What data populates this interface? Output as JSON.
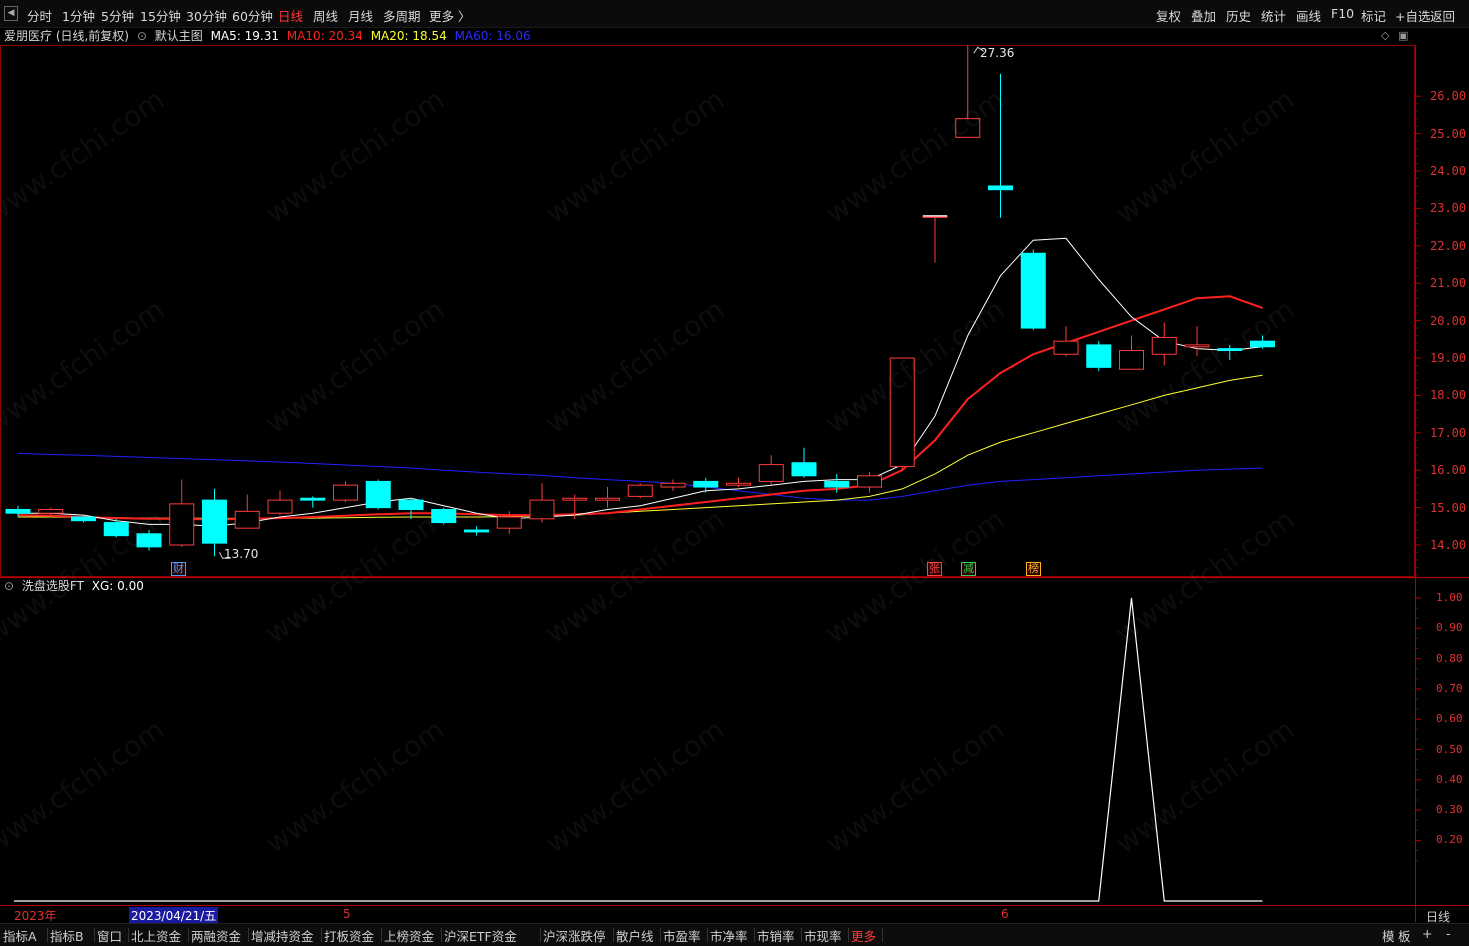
{
  "toolbar": {
    "periods": [
      "分时",
      "1分钟",
      "5分钟",
      "15分钟",
      "30分钟",
      "60分钟",
      "日线",
      "周线",
      "月线",
      "多周期",
      "更多 〉"
    ],
    "active_period": "日线",
    "tools": [
      "复权",
      "叠加",
      "历史",
      "统计",
      "画线",
      "F10",
      "标记",
      "+自选",
      "返回"
    ]
  },
  "main_legend": {
    "stock": "爱朋医疗 (日线,前复权)",
    "template": "默认主图",
    "ma5": "MA5: 19.31",
    "ma10": "MA10: 20.34",
    "ma20": "MA20: 18.54",
    "ma60": "MA60: 16.06"
  },
  "sub_legend": {
    "indicator": "洗盘选股FT",
    "xg": "XG: 0.00"
  },
  "colors": {
    "up": "#ff3b3b",
    "down": "#00ffff",
    "ma5": "#ffffff",
    "ma10": "#ff2020",
    "ma20": "#ffff30",
    "ma60": "#2020ff",
    "axis": "#e03030"
  },
  "price_axis": [
    "26.00",
    "25.00",
    "24.00",
    "23.00",
    "22.00",
    "21.00",
    "20.00",
    "19.00",
    "18.00",
    "17.00",
    "16.00",
    "15.00",
    "14.00"
  ],
  "indicator_axis": [
    "1.00",
    "0.90",
    "0.80",
    "0.70",
    "0.60",
    "0.50",
    "0.40",
    "0.30",
    "0.20"
  ],
  "annotations": {
    "high": "27.36",
    "low": "13.70"
  },
  "event_tags": [
    {
      "text": "财",
      "color": "#4aa0ff"
    },
    {
      "text": "张",
      "color": "#ff3b3b"
    },
    {
      "text": "减",
      "color": "#30d050"
    },
    {
      "text": "榜",
      "color": "#ffb020"
    }
  ],
  "date_axis": {
    "year": "2023年",
    "cursor": "2023/04/21/五",
    "month5": "5",
    "month6": "6",
    "period_label": "日线"
  },
  "bottom_tabs": [
    "指标A",
    "指标B",
    "窗口",
    "北上资金",
    "两融资金",
    "增减持资金",
    "打板资金",
    "上榜资金",
    "沪深ETF资金",
    "沪深涨跌停",
    "散户线",
    "市盈率",
    "市净率",
    "市销率",
    "市现率",
    "更多"
  ],
  "right_tabs": [
    "模",
    "板",
    "+",
    "-"
  ],
  "watermark": "www.cfchi.com",
  "chart_data": [
    {
      "type": "candlestick",
      "title": "爱朋医疗 (日线,前复权)",
      "ylim": [
        13.5,
        27.6
      ],
      "candles": [
        {
          "o": 14.95,
          "c": 14.85,
          "h": 15.05,
          "l": 14.75
        },
        {
          "o": 14.85,
          "c": 14.95,
          "h": 15.0,
          "l": 14.8
        },
        {
          "o": 14.75,
          "c": 14.65,
          "h": 14.8,
          "l": 14.6
        },
        {
          "o": 14.6,
          "c": 14.25,
          "h": 14.7,
          "l": 14.2
        },
        {
          "o": 14.3,
          "c": 13.95,
          "h": 14.4,
          "l": 13.85
        },
        {
          "o": 14.0,
          "c": 15.1,
          "h": 15.75,
          "l": 13.95
        },
        {
          "o": 15.2,
          "c": 14.05,
          "h": 15.5,
          "l": 13.7
        },
        {
          "o": 14.45,
          "c": 14.9,
          "h": 15.35,
          "l": 14.45
        },
        {
          "o": 14.85,
          "c": 15.2,
          "h": 15.45,
          "l": 14.8
        },
        {
          "o": 15.25,
          "c": 15.2,
          "h": 15.3,
          "l": 15.0
        },
        {
          "o": 15.2,
          "c": 15.6,
          "h": 15.7,
          "l": 15.15
        },
        {
          "o": 15.7,
          "c": 15.0,
          "h": 15.75,
          "l": 14.95
        },
        {
          "o": 15.2,
          "c": 14.95,
          "h": 15.25,
          "l": 14.7
        },
        {
          "o": 14.95,
          "c": 14.6,
          "h": 15.0,
          "l": 14.55
        },
        {
          "o": 14.4,
          "c": 14.35,
          "h": 14.5,
          "l": 14.25
        },
        {
          "o": 14.45,
          "c": 14.75,
          "h": 14.9,
          "l": 14.3
        },
        {
          "o": 14.7,
          "c": 15.2,
          "h": 15.65,
          "l": 14.6
        },
        {
          "o": 15.2,
          "c": 15.25,
          "h": 15.35,
          "l": 14.7
        },
        {
          "o": 15.2,
          "c": 15.25,
          "h": 15.55,
          "l": 15.0
        },
        {
          "o": 15.3,
          "c": 15.6,
          "h": 15.65,
          "l": 15.25
        },
        {
          "o": 15.55,
          "c": 15.65,
          "h": 15.75,
          "l": 15.45
        },
        {
          "o": 15.7,
          "c": 15.55,
          "h": 15.8,
          "l": 15.4
        },
        {
          "o": 15.6,
          "c": 15.65,
          "h": 15.8,
          "l": 15.55
        },
        {
          "o": 15.7,
          "c": 16.15,
          "h": 16.4,
          "l": 15.6
        },
        {
          "o": 16.2,
          "c": 15.85,
          "h": 16.6,
          "l": 15.8
        },
        {
          "o": 15.7,
          "c": 15.55,
          "h": 15.9,
          "l": 15.4
        },
        {
          "o": 15.55,
          "c": 15.85,
          "h": 15.95,
          "l": 15.4
        },
        {
          "o": 16.1,
          "c": 19.0,
          "h": 19.0,
          "l": 16.0
        },
        {
          "o": 22.8,
          "c": 22.8,
          "h": 22.8,
          "l": 21.55
        },
        {
          "o": 24.9,
          "c": 25.4,
          "h": 27.36,
          "l": 25.15
        },
        {
          "o": 23.6,
          "c": 23.5,
          "h": 26.6,
          "l": 22.75
        },
        {
          "o": 21.8,
          "c": 19.8,
          "h": 21.9,
          "l": 19.75
        },
        {
          "o": 19.1,
          "c": 19.45,
          "h": 19.85,
          "l": 19.05
        },
        {
          "o": 19.35,
          "c": 18.75,
          "h": 19.45,
          "l": 18.65
        },
        {
          "o": 18.7,
          "c": 19.2,
          "h": 19.6,
          "l": 18.7
        },
        {
          "o": 19.1,
          "c": 19.55,
          "h": 19.95,
          "l": 18.8
        },
        {
          "o": 19.3,
          "c": 19.35,
          "h": 19.85,
          "l": 19.05
        },
        {
          "o": 19.25,
          "c": 19.2,
          "h": 19.35,
          "l": 18.95
        },
        {
          "o": 19.45,
          "c": 19.3,
          "h": 19.6,
          "l": 19.25
        }
      ],
      "series": [
        {
          "name": "MA5",
          "values": [
            14.85,
            14.85,
            14.8,
            14.65,
            14.55,
            14.55,
            14.5,
            14.6,
            14.75,
            14.85,
            15.0,
            15.15,
            15.25,
            15.05,
            14.85,
            14.7,
            14.75,
            14.8,
            14.95,
            15.05,
            15.25,
            15.45,
            15.5,
            15.6,
            15.7,
            15.75,
            15.75,
            16.15,
            17.45,
            19.6,
            21.2,
            22.15,
            22.2,
            21.1,
            20.1,
            19.45,
            19.25,
            19.2,
            19.3
          ]
        },
        {
          "name": "MA10",
          "values": [
            14.8,
            14.78,
            14.75,
            14.72,
            14.7,
            14.7,
            14.68,
            14.7,
            14.72,
            14.75,
            14.78,
            14.82,
            14.85,
            14.85,
            14.82,
            14.8,
            14.8,
            14.82,
            14.85,
            14.95,
            15.05,
            15.15,
            15.25,
            15.35,
            15.45,
            15.5,
            15.6,
            16.0,
            16.8,
            17.9,
            18.6,
            19.1,
            19.4,
            19.7,
            20.0,
            20.3,
            20.6,
            20.65,
            20.34
          ]
        },
        {
          "name": "MA20",
          "values": [
            14.75,
            14.75,
            14.74,
            14.73,
            14.72,
            14.72,
            14.71,
            14.71,
            14.72,
            14.72,
            14.73,
            14.74,
            14.75,
            14.75,
            14.75,
            14.76,
            14.78,
            14.8,
            14.85,
            14.9,
            14.95,
            15.0,
            15.05,
            15.1,
            15.15,
            15.2,
            15.3,
            15.5,
            15.9,
            16.4,
            16.75,
            17.0,
            17.25,
            17.5,
            17.75,
            18.0,
            18.2,
            18.4,
            18.54
          ]
        },
        {
          "name": "MA60",
          "values": [
            16.45,
            16.42,
            16.4,
            16.37,
            16.34,
            16.31,
            16.28,
            16.25,
            16.22,
            16.18,
            16.14,
            16.1,
            16.06,
            16.0,
            15.95,
            15.9,
            15.86,
            15.8,
            15.75,
            15.7,
            15.65,
            15.55,
            15.45,
            15.35,
            15.25,
            15.2,
            15.2,
            15.3,
            15.45,
            15.6,
            15.7,
            15.75,
            15.8,
            15.85,
            15.9,
            15.95,
            16.0,
            16.03,
            16.06
          ]
        }
      ]
    },
    {
      "type": "line",
      "title": "洗盘选股FT",
      "ylim": [
        0,
        1.0
      ],
      "series": [
        {
          "name": "XG",
          "values": [
            0,
            0,
            0,
            0,
            0,
            0,
            0,
            0,
            0,
            0,
            0,
            0,
            0,
            0,
            0,
            0,
            0,
            0,
            0,
            0,
            0,
            0,
            0,
            0,
            0,
            0,
            0,
            0,
            0,
            0,
            0,
            0,
            0,
            0,
            1,
            0,
            0,
            0,
            0
          ]
        }
      ]
    }
  ]
}
